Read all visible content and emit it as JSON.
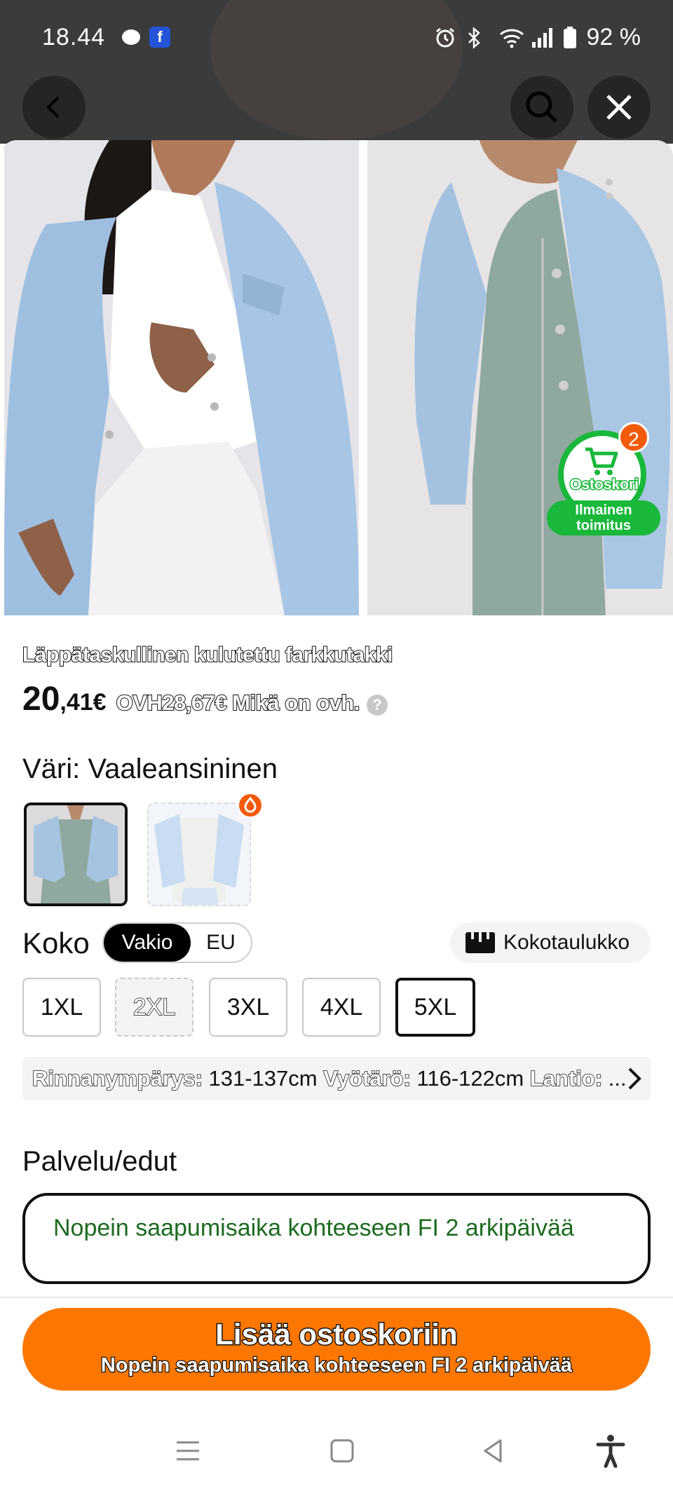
{
  "status_bar": {
    "time": "18.44",
    "battery": "92 %",
    "icons": [
      "chat-bubble-icon",
      "app-notification-icon",
      "alarm-icon",
      "bluetooth-icon",
      "wifi-icon",
      "signal-icon",
      "battery-icon"
    ]
  },
  "nav": {
    "icons": [
      "back-arrow-icon",
      "search-icon",
      "close-icon"
    ]
  },
  "cart_badge": {
    "count": "2",
    "label": "Ostoskori",
    "shipping_line1": "Ilmainen",
    "shipping_line2": "toimitus"
  },
  "product": {
    "title": "Läppätaskullinen kulutettu farkkutakki",
    "price_whole": "20",
    "price_rest": ",41€",
    "original_price": "OVH28,67€ Mikä on ovh.",
    "help_symbol": "?"
  },
  "color": {
    "label": "Väri: Vaaleansininen",
    "swatches": [
      {
        "name": "Vaaleansininen",
        "selected": true
      },
      {
        "name": "Valkoinen",
        "selected": false,
        "hot": true
      }
    ]
  },
  "size": {
    "label": "Koko",
    "toggle": [
      "Vakio",
      "EU"
    ],
    "toggle_selected": "Vakio",
    "chart_label": "Kokotaulukko",
    "options": [
      "1XL",
      "2XL",
      "3XL",
      "4XL",
      "5XL"
    ],
    "unavailable": [
      "2XL"
    ],
    "selected": "5XL",
    "measure_k1": "Rinnanympärys:",
    "measure_v1": " 131-137cm ",
    "measure_k2": "Vyötärö:",
    "measure_v2": " 116-122cm ",
    "measure_k3": "Lantio:",
    "measure_v3": " ..."
  },
  "service": {
    "title": "Palvelu/edut",
    "text": "Nopein saapumisaika kohteeseen FI 2 arkipäivää"
  },
  "cta": {
    "label": "Lisää ostoskoriin",
    "sublabel": "Nopein saapumisaika kohteeseen FI 2 arkipäivää"
  },
  "colors": {
    "accent_orange": "#fb7701",
    "badge_green": "#19b83b",
    "service_green": "#1c6b1f"
  }
}
